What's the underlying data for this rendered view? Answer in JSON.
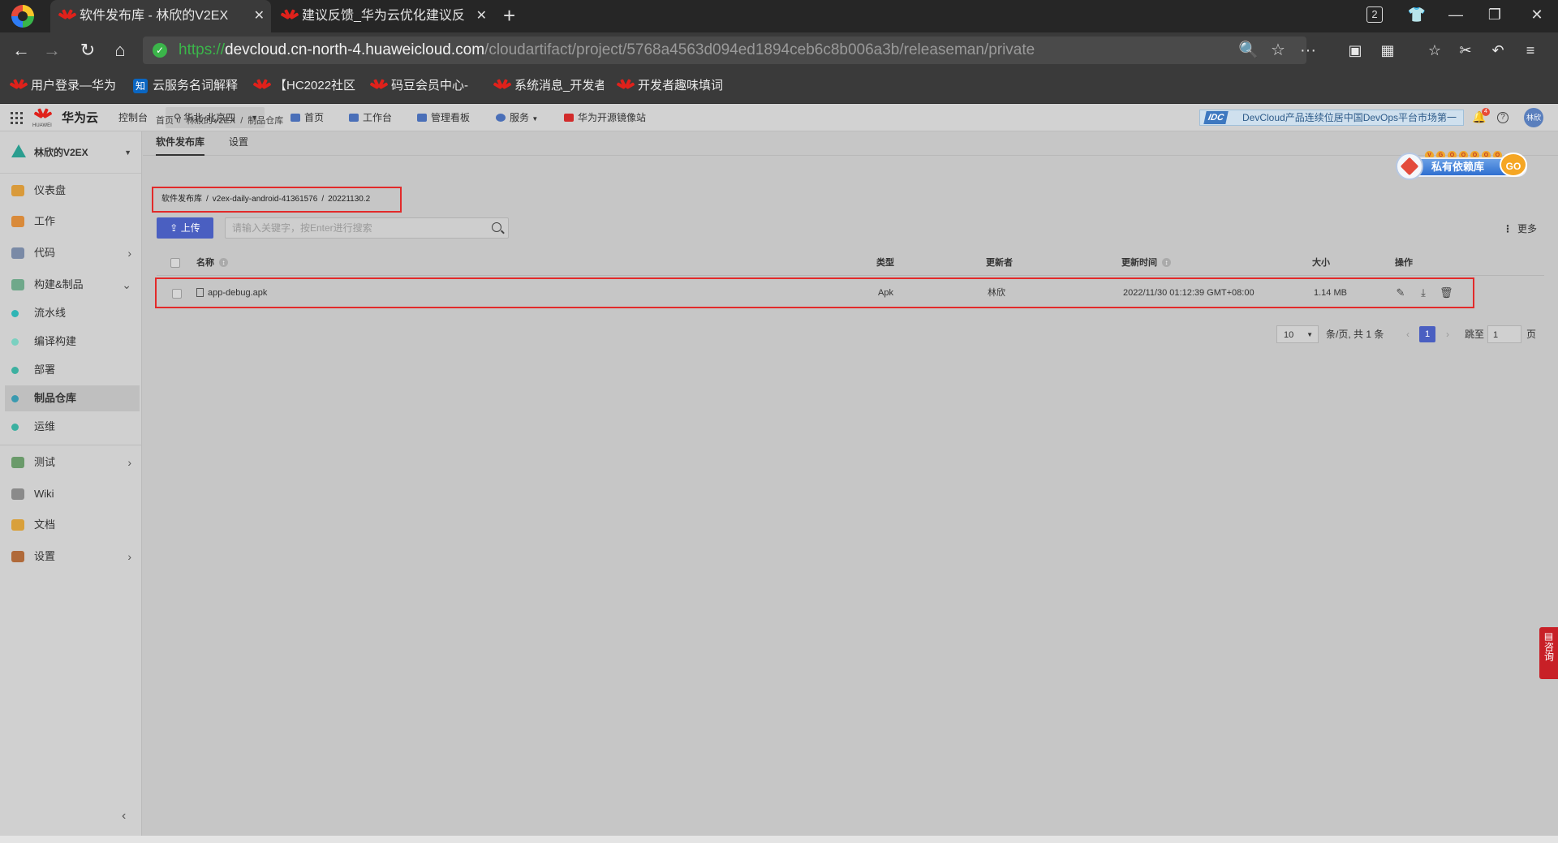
{
  "browser": {
    "tabs": [
      {
        "title": "软件发布库 - 林欣的V2EX",
        "active": true
      },
      {
        "title": "建议反馈_华为云优化建议反馈",
        "active": false
      }
    ],
    "tab_count": "2",
    "url_scheme": "https://",
    "url_host": "devcloud.cn-north-4.huaweicloud.com",
    "url_path": "/cloudartifact/project/5768a4563d094ed1894ceb6c8b006a3b/releaseman/private",
    "bookmarks": [
      "用户登录—华为",
      "云服务名词解释",
      "【HC2022社区",
      "码豆会员中心-",
      "系统消息_开发者",
      "开发者趣味填词"
    ]
  },
  "topnav": {
    "brand": "华为云",
    "brand_sub": "HUAWEI",
    "console": "控制台",
    "region": "华北-北京四",
    "items": [
      "首页",
      "工作台",
      "管理看板",
      "服务",
      "华为开源镜像站"
    ],
    "banner_badge": "IDC",
    "banner_text": "DevCloud产品连续位居中国DevOps平台市场第一",
    "notification_count": "4",
    "avatar_text": "林欣"
  },
  "sidebar": {
    "project": "林欣的V2EX",
    "items": [
      {
        "label": "仪表盘",
        "color": "#d99a3a"
      },
      {
        "label": "工作",
        "color": "#d98a3a"
      },
      {
        "label": "代码",
        "color": "#7a8aa6",
        "chevron": "›"
      },
      {
        "label": "构建&制品",
        "color": "#6fa88a",
        "chevron": "⌄"
      },
      {
        "label": "流水线",
        "color": "#2fb5b5"
      },
      {
        "label": "编译构建",
        "color": "#7ad0c0"
      },
      {
        "label": "部署",
        "color": "#3cb0a0"
      },
      {
        "label": "制品仓库",
        "color": "#3a9ab0"
      },
      {
        "label": "运维",
        "color": "#3ab0a0"
      },
      {
        "label": "测试",
        "color": "#6a9a6a",
        "chevron": "›"
      },
      {
        "label": "Wiki",
        "color": "#8a8a8a"
      },
      {
        "label": "文档",
        "color": "#d9a03a"
      },
      {
        "label": "设置",
        "color": "#b06a3a",
        "chevron": "›"
      }
    ],
    "collapse": "‹"
  },
  "content": {
    "breadcrumb": [
      "首页",
      "/",
      "林欣的V2EX",
      "/",
      "制品仓库"
    ],
    "tabs": [
      "软件发布库",
      "设置"
    ],
    "promo_text": "私有依赖库",
    "promo_go": "GO",
    "promo_dots": [
      "V",
      "G",
      "O",
      "O",
      "O",
      "O",
      "O"
    ],
    "path": [
      "软件发布库",
      "/",
      "v2ex-daily-android-41361576",
      "/",
      "20221130.2"
    ],
    "upload_label": "上传",
    "search_placeholder": "请输入关键字，按Enter进行搜索",
    "more_label": "更多",
    "columns": {
      "name": "名称",
      "type": "类型",
      "updater": "更新者",
      "updated_at": "更新时间",
      "size": "大小",
      "actions": "操作"
    },
    "rows": [
      {
        "name": "app-debug.apk",
        "type": "Apk",
        "updater": "林欣",
        "updated_at": "2022/11/30 01:12:39 GMT+08:00",
        "size": "1.14 MB"
      }
    ],
    "pagination": {
      "page_size": "10",
      "summary": "条/页, 共 1 条",
      "current": "1",
      "jump_label": "跳至",
      "jump_value": "1",
      "page_unit": "页"
    }
  },
  "consult": "咨询"
}
